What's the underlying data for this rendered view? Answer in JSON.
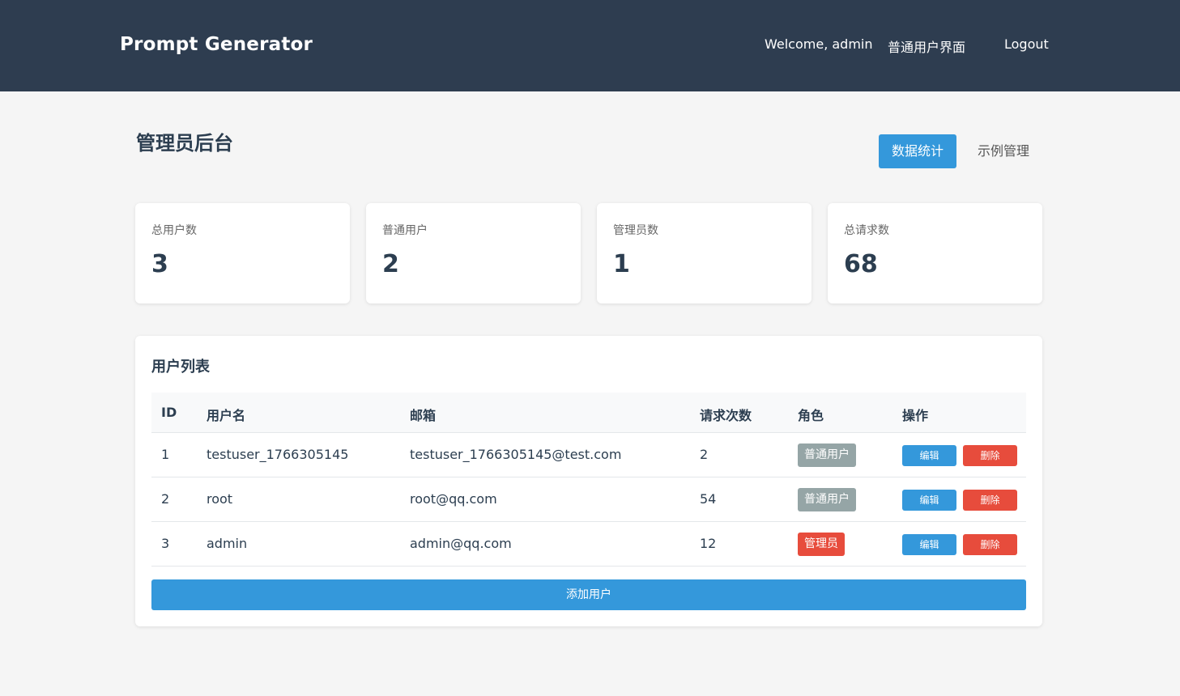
{
  "header": {
    "brand": "Prompt Generator",
    "welcome": "Welcome, admin",
    "user_view_link": "普通用户界面",
    "logout_link": "Logout"
  },
  "page": {
    "title": "管理员后台",
    "tabs": [
      {
        "label": "数据统计",
        "active": true
      },
      {
        "label": "示例管理",
        "active": false
      }
    ]
  },
  "stats": [
    {
      "label": "总用户数",
      "value": "3"
    },
    {
      "label": "普通用户",
      "value": "2"
    },
    {
      "label": "管理员数",
      "value": "1"
    },
    {
      "label": "总请求数",
      "value": "68"
    }
  ],
  "users": {
    "title": "用户列表",
    "columns": [
      "ID",
      "用户名",
      "邮箱",
      "请求次数",
      "角色",
      "操作"
    ],
    "rows": [
      {
        "id": "1",
        "username": "testuser_1766305145",
        "email": "testuser_1766305145@test.com",
        "requests": "2",
        "role": "普通用户",
        "edit": "编辑",
        "delete": "删除"
      },
      {
        "id": "2",
        "username": "root",
        "email": "root@qq.com",
        "requests": "54",
        "role": "普通用户",
        "edit": "编辑",
        "delete": "删除"
      },
      {
        "id": "3",
        "username": "admin",
        "email": "admin@qq.com",
        "requests": "12",
        "role": "管理员",
        "edit": "编辑",
        "delete": "删除"
      }
    ],
    "add_button": "添加用户"
  },
  "colors": {
    "header_bg": "#2e3d50",
    "primary": "#3498db",
    "danger": "#e74c3c",
    "badge_normal": "#95a5a6"
  }
}
